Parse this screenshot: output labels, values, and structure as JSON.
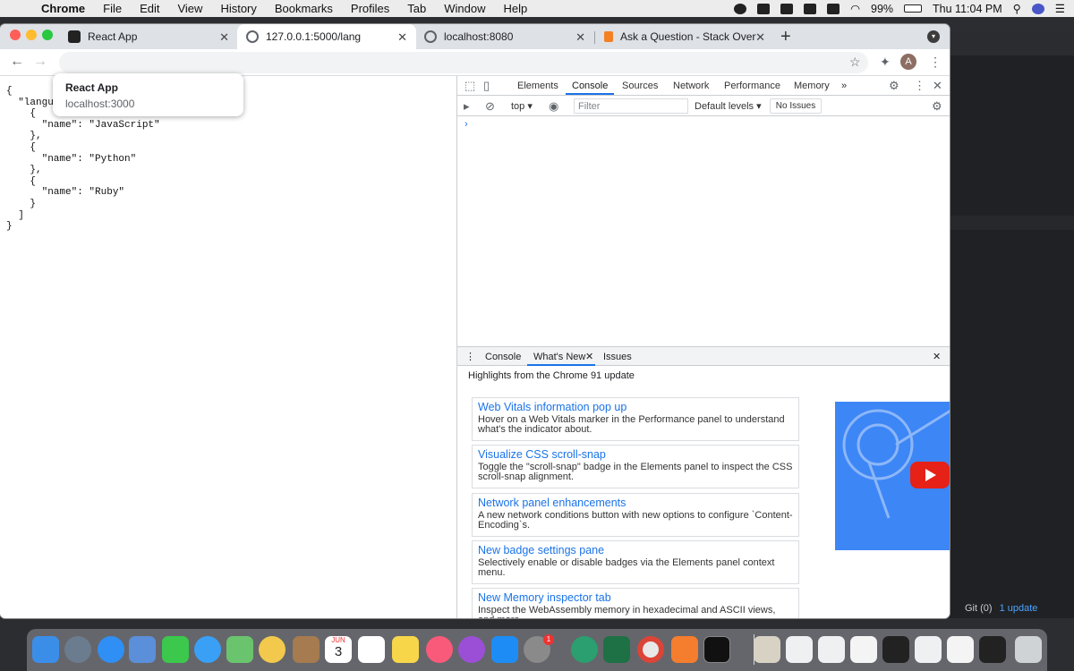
{
  "menubar": {
    "app_name": "Chrome",
    "items": [
      "File",
      "Edit",
      "View",
      "History",
      "Bookmarks",
      "Profiles",
      "Tab",
      "Window",
      "Help"
    ],
    "battery": "99%",
    "clock": "Thu 11:04 PM"
  },
  "tabs": [
    {
      "title": "React App",
      "favicon": "react-icon",
      "active": false
    },
    {
      "title": "127.0.0.1:5000/lang",
      "favicon": "globe-icon",
      "active": true
    },
    {
      "title": "localhost:8080",
      "favicon": "globe-icon",
      "active": false
    },
    {
      "title": "Ask a Question - Stack Overflo",
      "favicon": "stackoverflow-icon",
      "active": false
    }
  ],
  "tooltip": {
    "title": "React App",
    "url": "localhost:3000"
  },
  "toolbar": {
    "avatar_letter": "A"
  },
  "page": {
    "json_text": "{\n  \"languages\": [\n    {\n      \"name\": \"JavaScript\"\n    },\n    {\n      \"name\": \"Python\"\n    },\n    {\n      \"name\": \"Ruby\"\n    }\n  ]\n}"
  },
  "devtools": {
    "panel_tabs": [
      "Elements",
      "Console",
      "Sources",
      "Network",
      "Performance",
      "Memory"
    ],
    "active_panel": "Console",
    "more_tabs": "»",
    "context": "top",
    "filter_placeholder": "Filter",
    "levels": "Default levels",
    "no_issues": "No Issues",
    "prompt": "›",
    "drawer_tabs": [
      "Console",
      "What's New",
      "Issues"
    ],
    "drawer_active": "What's New",
    "highlights": "Highlights from the Chrome 91 update",
    "whats_new": [
      {
        "title": "Web Vitals information pop up",
        "desc": "Hover on a Web Vitals marker in the Performance panel to understand what's the indicator about."
      },
      {
        "title": "Visualize CSS scroll-snap",
        "desc": "Toggle the \"scroll-snap\" badge in the Elements panel to inspect the CSS scroll-snap alignment."
      },
      {
        "title": "Network panel enhancements",
        "desc": "A new network conditions button with new options to configure `Content-Encoding`s."
      },
      {
        "title": "New badge settings pane",
        "desc": "Selectively enable or disable badges via the Elements panel context menu."
      },
      {
        "title": "New Memory inspector tab",
        "desc": "Inspect the WebAssembly memory in hexadecimal and ASCII views, and more."
      }
    ]
  },
  "background_editor": {
    "git": "Git (0)",
    "update": "1 update"
  },
  "dock": {
    "calendar_month": "JUN",
    "calendar_day": "3",
    "badge": "1"
  },
  "colors": {
    "accent": "#1a73e8",
    "tab_strip": "#dee1e6",
    "video_bg": "#3d86f6",
    "youtube_red": "#e62117"
  }
}
